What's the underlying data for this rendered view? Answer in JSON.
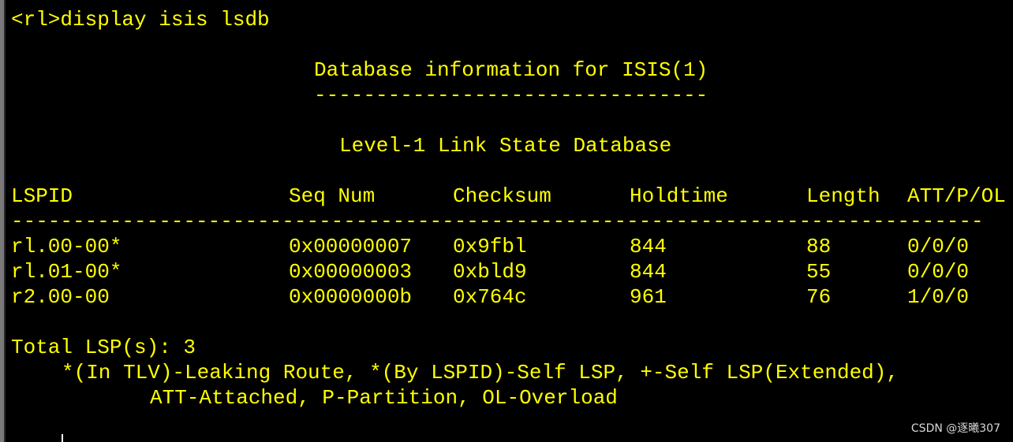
{
  "terminal": {
    "command_line": "<rl>display isis lsdb",
    "db_title": "Database information for ISIS(1)",
    "db_title_underline": "--------------------------------",
    "level_title": "Level-1 Link State Database",
    "table": {
      "headers": [
        "LSPID",
        "Seq Num",
        "Checksum",
        "Holdtime",
        "Length",
        "ATT/P/OL"
      ],
      "separator": "-------------------------------------------------------------------------------",
      "rows": [
        [
          "rl.00-00*",
          "0x00000007",
          "0x9fbl",
          "844",
          "88",
          "0/0/0"
        ],
        [
          "rl.01-00*",
          "0x00000003",
          "0xbld9",
          "844",
          "55",
          "0/0/0"
        ],
        [
          "r2.00-00",
          "0x0000000b",
          "0x764c",
          "961",
          "76",
          "1/0/0"
        ]
      ]
    },
    "total_line": "Total LSP(s): 3",
    "legend_line1": "*(In TLV)-Leaking Route, *(By LSPID)-Self LSP, +-Self LSP(Extended),",
    "legend_line2": "ATT-Attached, P-Partition, OL-Overload"
  },
  "watermark": "CSDN @逐曦307",
  "colors": {
    "background": "#000000",
    "text": "#ffff00"
  }
}
